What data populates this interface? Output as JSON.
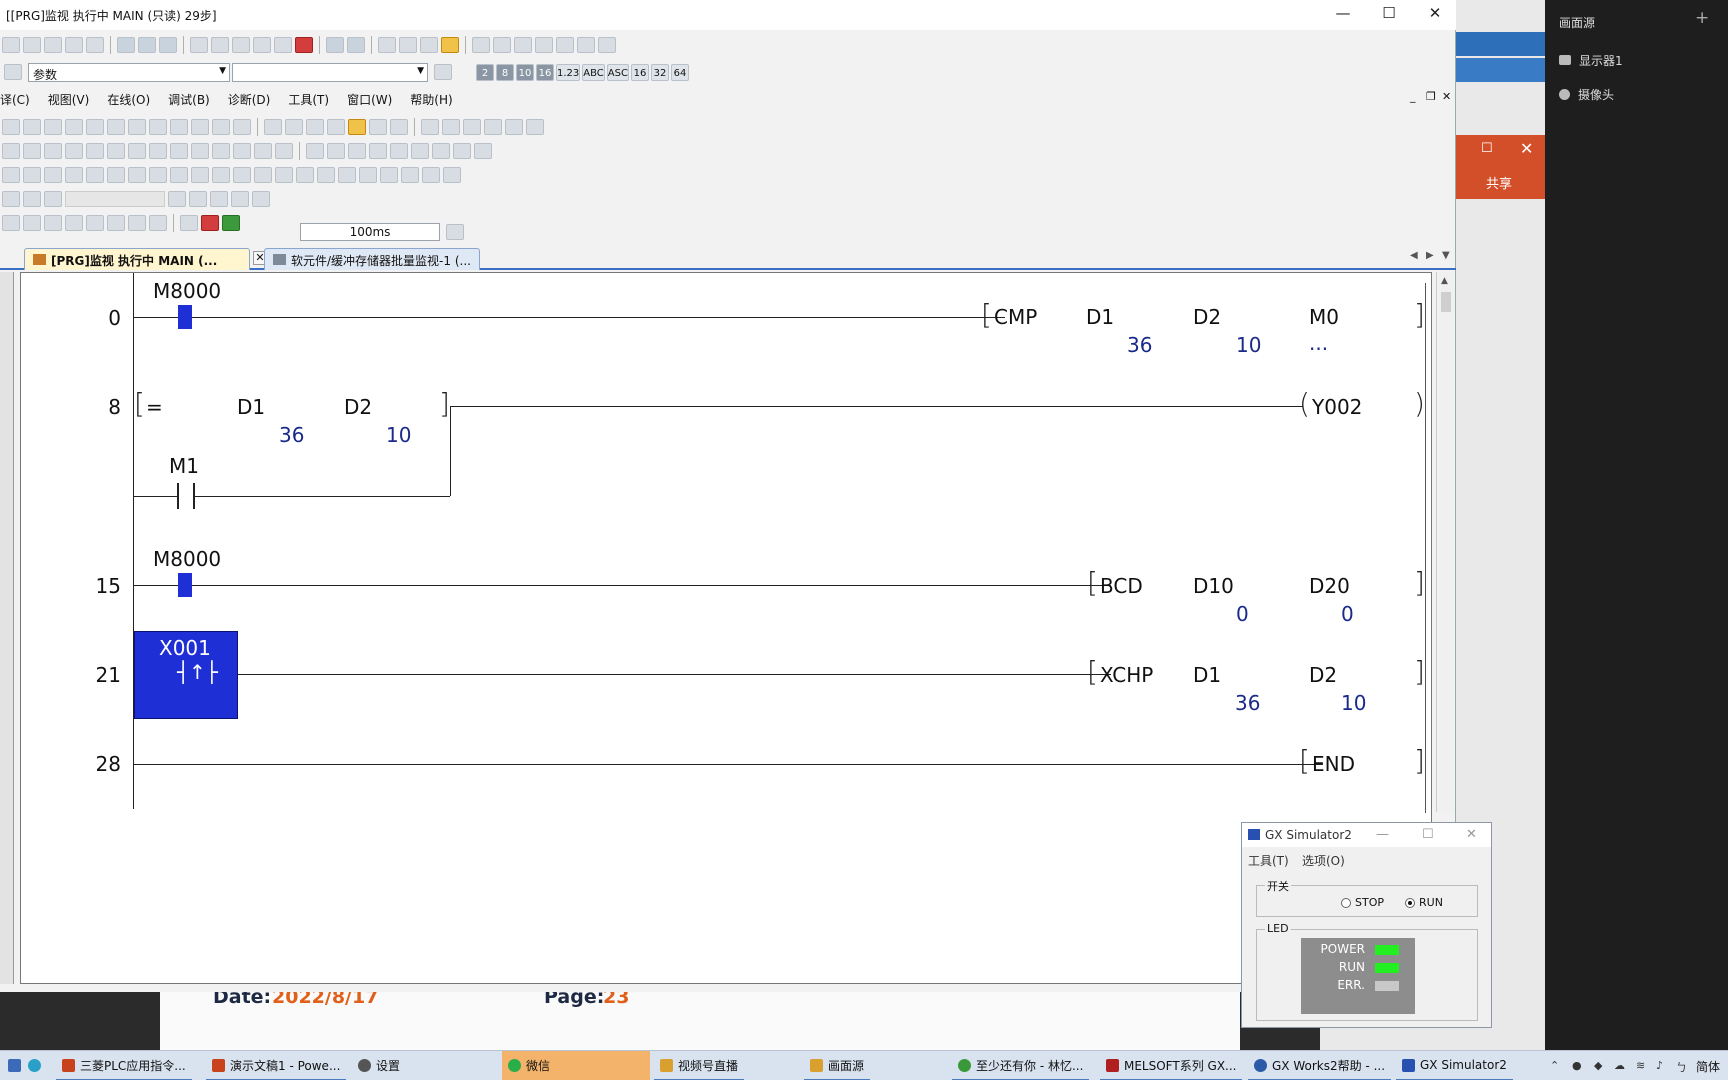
{
  "window": {
    "title": "[[PRG]监视 执行中 MAIN (只读) 29步]",
    "min": "—",
    "max": "☐",
    "close": "✕"
  },
  "toolbar": {
    "param_combo": "参数",
    "interval": "100ms",
    "num_buttons": [
      "2",
      "8",
      "10",
      "16",
      "1.23",
      "ABC",
      "ASC",
      "16",
      "32",
      "64"
    ]
  },
  "menu": [
    "译(C)",
    "视图(V)",
    "在线(O)",
    "调试(B)",
    "诊断(D)",
    "工具(T)",
    "窗口(W)",
    "帮助(H)"
  ],
  "tabs": [
    {
      "label": "[PRG]监视 执行中 MAIN (..."
    },
    {
      "label": "软元件/缓冲存储器批量监视-1 (..."
    }
  ],
  "ladder": {
    "rungs": [
      {
        "step": "0",
        "contact": "M8000",
        "instr": "CMP",
        "ops": [
          "D1",
          "D2",
          "M0"
        ],
        "vals": [
          "36",
          "10",
          "..."
        ]
      },
      {
        "step": "8",
        "cmp": "=",
        "ops": [
          "D1",
          "D2"
        ],
        "vals": [
          "36",
          "10"
        ],
        "coil": "Y002",
        "parallel": "M1"
      },
      {
        "step": "15",
        "contact": "M8000",
        "instr": "BCD",
        "ops": [
          "D10",
          "D20"
        ],
        "vals": [
          "0",
          "0"
        ]
      },
      {
        "step": "21",
        "contact": "X001",
        "instr": "XCHP",
        "ops": [
          "D1",
          "D2"
        ],
        "vals": [
          "36",
          "10"
        ]
      },
      {
        "step": "28",
        "instr": "END"
      }
    ]
  },
  "simulator": {
    "title": "GX Simulator2",
    "menu_tools": "工具(T)",
    "menu_options": "选项(O)",
    "switch_label": "开关",
    "stop": "STOP",
    "run": "RUN",
    "mode": "RUN",
    "led_label": "LED",
    "leds": [
      {
        "name": "POWER",
        "color": "#22ee22"
      },
      {
        "name": "RUN",
        "color": "#22ee22"
      },
      {
        "name": "ERR.",
        "color": "#c8c8c8"
      }
    ]
  },
  "background": {
    "share": "共享",
    "date_label": "Date:",
    "date_value": "2022/8/17",
    "page_label": "Page:",
    "page_value": "23"
  },
  "sources": {
    "title": "画面源",
    "items": [
      "显示器1",
      "摄像头"
    ]
  },
  "taskbar": {
    "items": [
      {
        "label": "三菱PLC应用指令...",
        "color": "#c8421e"
      },
      {
        "label": "演示文稿1 - Powe...",
        "color": "#c8421e"
      },
      {
        "label": "设置",
        "color": "#555555"
      },
      {
        "label": "微信",
        "color": "#2aae4a"
      },
      {
        "label": "视频号直播",
        "color": "#d9a030"
      },
      {
        "label": "画面源",
        "color": "#d9a030"
      },
      {
        "label": "至少还有你 - 林忆...",
        "color": "#3a9a3a"
      },
      {
        "label": "MELSOFT系列 GX...",
        "color": "#b02020"
      },
      {
        "label": "GX Works2帮助 - ...",
        "color": "#2a5aa8"
      },
      {
        "label": "GX Simulator2",
        "color": "#2850b0"
      }
    ],
    "ime": "简体"
  },
  "colors": {
    "contact_on": "#1f2fd6",
    "value_text": "#1a2a8a",
    "tab_active": "#fff6cf"
  }
}
